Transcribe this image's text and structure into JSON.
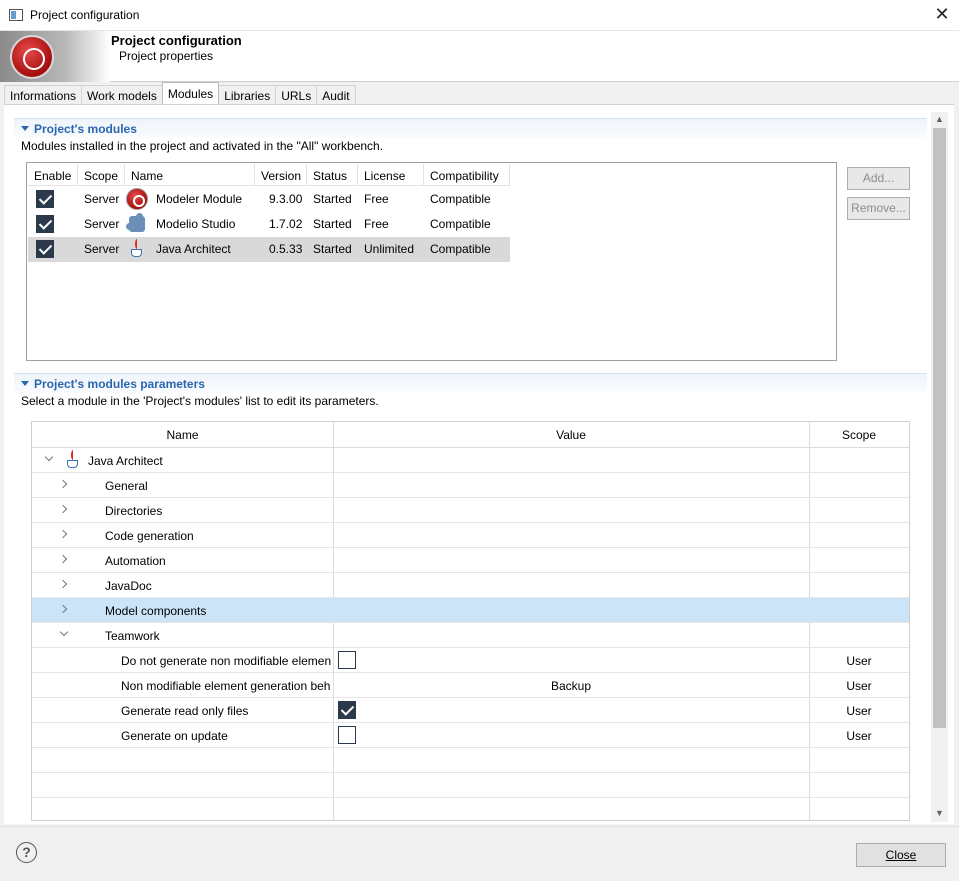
{
  "window": {
    "title": "Project configuration",
    "close_glyph": "✕"
  },
  "banner": {
    "title": "Project configuration",
    "subtitle": "Project properties"
  },
  "tabs": [
    {
      "label": "Informations"
    },
    {
      "label": "Work models"
    },
    {
      "label": "Modules",
      "active": true
    },
    {
      "label": "Libraries"
    },
    {
      "label": "URLs"
    },
    {
      "label": "Audit"
    }
  ],
  "modules_section": {
    "title": "Project's modules",
    "description": "Modules installed in the project and activated in the \"All\" workbench.",
    "columns": [
      "Enable",
      "Scope",
      "Name",
      "Version",
      "Status",
      "License",
      "Compatibility"
    ],
    "rows": [
      {
        "enabled": true,
        "scope": "Server",
        "icon": "modeler-module-icon",
        "name": "Modeler Module",
        "version": "9.3.00",
        "status": "Started",
        "license": "Free",
        "compatibility": "Compatible"
      },
      {
        "enabled": true,
        "scope": "Server",
        "icon": "puzzle-piece-icon",
        "name": "Modelio Studio",
        "version": "1.7.02",
        "status": "Started",
        "license": "Free",
        "compatibility": "Compatible"
      },
      {
        "enabled": true,
        "scope": "Server",
        "icon": "java-cup-icon",
        "name": "Java Architect",
        "version": "0.5.33",
        "status": "Started",
        "license": "Unlimited",
        "compatibility": "Compatible",
        "selected": true
      }
    ],
    "add_label": "Add...",
    "remove_label": "Remove..."
  },
  "params_section": {
    "title": "Project's modules parameters",
    "description": "Select a module in the 'Project's modules' list to edit its parameters.",
    "columns": {
      "name": "Name",
      "value": "Value",
      "scope": "Scope"
    },
    "root": {
      "label": "Java Architect",
      "icon": "java-cup-icon"
    },
    "groups": [
      {
        "label": "General"
      },
      {
        "label": "Directories"
      },
      {
        "label": "Code generation"
      },
      {
        "label": "Automation"
      },
      {
        "label": "JavaDoc"
      },
      {
        "label": "Model components",
        "selected": true
      },
      {
        "label": "Teamwork",
        "expanded": true
      }
    ],
    "teamwork_params": [
      {
        "label": "Do not generate non modifiable elemen",
        "type": "checkbox",
        "checked": false,
        "scope": "User"
      },
      {
        "label": "Non modifiable element generation beh",
        "type": "text",
        "value": "Backup",
        "scope": "User"
      },
      {
        "label": "Generate read only files",
        "type": "checkbox",
        "checked": true,
        "scope": "User"
      },
      {
        "label": "Generate on update",
        "type": "checkbox",
        "checked": false,
        "scope": "User"
      }
    ]
  },
  "footer": {
    "help_glyph": "?",
    "close_label": "Close"
  },
  "colors": {
    "section_title": "#2a66b0",
    "selection_blue": "#cce4f7",
    "checkbox_dark": "#2b3a4a"
  }
}
